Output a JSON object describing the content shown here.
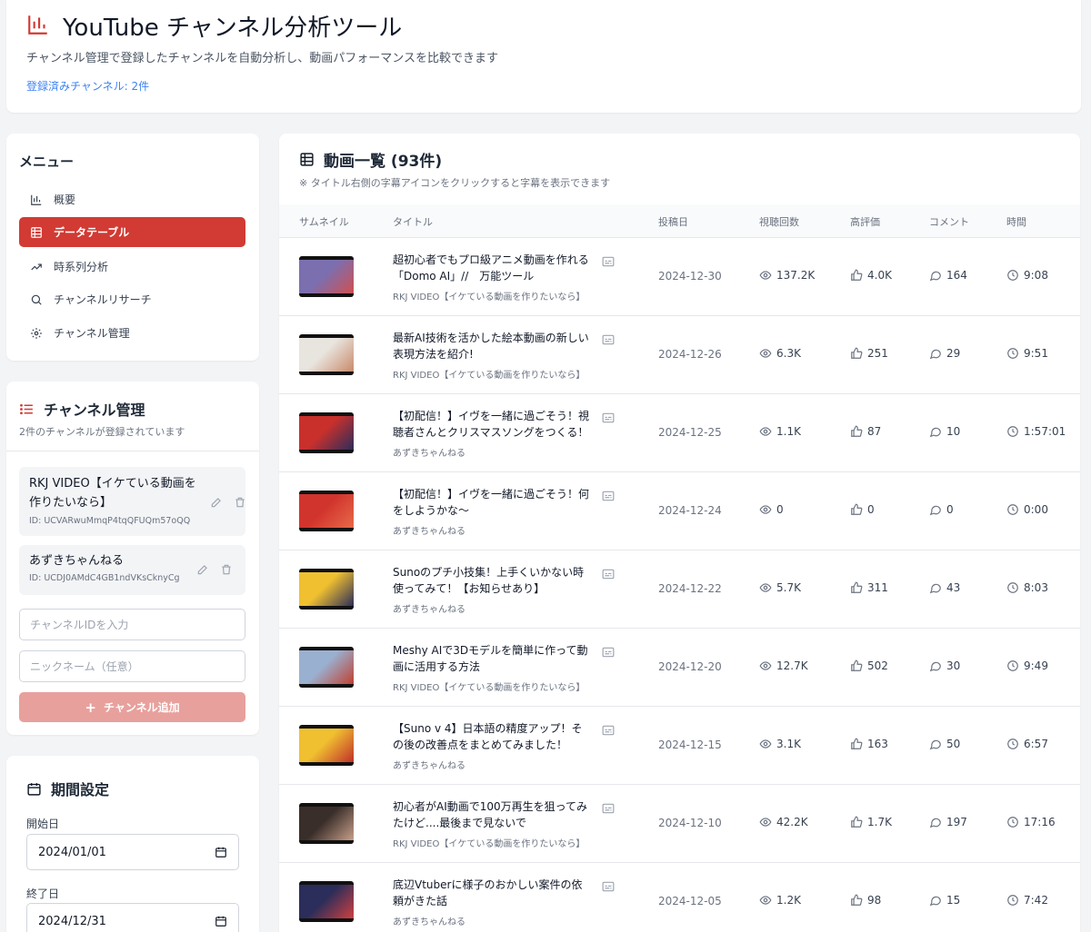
{
  "header": {
    "title": "YouTube チャンネル分析ツール",
    "subtitle": "チャンネル管理で登録したチャンネルを自動分析し、動画パフォーマンスを比較できます",
    "registered": "登録済みチャンネル: 2件",
    "icon": "bar-chart-icon"
  },
  "menu": {
    "heading": "メニュー",
    "items": [
      {
        "label": "概要",
        "icon": "bar-chart-icon",
        "active": false
      },
      {
        "label": "データテーブル",
        "icon": "table-icon",
        "active": true
      },
      {
        "label": "時系列分析",
        "icon": "trend-icon",
        "active": false
      },
      {
        "label": "チャンネルリサーチ",
        "icon": "search-icon",
        "active": false
      },
      {
        "label": "チャンネル管理",
        "icon": "gear-icon",
        "active": false
      }
    ]
  },
  "channel_mgmt": {
    "title": "チャンネル管理",
    "subtitle": "2件のチャンネルが登録されています",
    "channels": [
      {
        "name_line1": "RKJ VIDEO【イケている動画を",
        "name_line2": "作りたいなら】",
        "id": "ID: UCVARwuMmqP4tqQFUQm57oQQ"
      },
      {
        "name_line1": "あずきちゃんねる",
        "id": "ID: UCDJ0AMdC4GB1ndVKsCknyCg"
      }
    ],
    "id_placeholder": "チャンネルIDを入力",
    "nick_placeholder": "ニックネーム（任意）",
    "add_label": "チャンネル追加"
  },
  "period": {
    "title": "期間設定",
    "start_label": "開始日",
    "start_value": "2024/01/01",
    "end_label": "終了日",
    "end_value": "2024/12/31"
  },
  "videos": {
    "title": "動画一覧 (93件)",
    "note": "※ タイトル右側の字幕アイコンをクリックすると字幕を表示できます",
    "columns": [
      "サムネイル",
      "タイトル",
      "投稿日",
      "視聴回数",
      "高評価",
      "コメント",
      "時間"
    ],
    "rows": [
      {
        "title": "超初心者でもプロ級アニメ動画を作れる「Domo AI」//　万能ツール",
        "channel": "RKJ VIDEO【イケている動画を作りたいなら】",
        "date": "2024-12-30",
        "views": "137.2K",
        "likes": "4.0K",
        "comments": "164",
        "duration": "9:08",
        "thumb_colors": [
          "#7b6fb0",
          "#d05050"
        ]
      },
      {
        "title": "最新AI技術を活かした絵本動画の新しい表現方法を紹介!",
        "channel": "RKJ VIDEO【イケている動画を作りたいなら】",
        "date": "2024-12-26",
        "views": "6.3K",
        "likes": "251",
        "comments": "29",
        "duration": "9:51",
        "thumb_colors": [
          "#e8e4de",
          "#c88a6a"
        ]
      },
      {
        "title": "【初配信！】イヴを一緒に過ごそう！視聴者さんとクリスマスソングをつくる！",
        "channel": "あずきちゃんねる",
        "date": "2024-12-25",
        "views": "1.1K",
        "likes": "87",
        "comments": "10",
        "duration": "1:57:01",
        "thumb_colors": [
          "#c9302c",
          "#2b2d5a"
        ]
      },
      {
        "title": "【初配信！】イヴを一緒に過ごそう！何をしようかな〜",
        "channel": "あずきちゃんねる",
        "date": "2024-12-24",
        "views": "0",
        "likes": "0",
        "comments": "0",
        "duration": "0:00",
        "thumb_colors": [
          "#d1342c",
          "#e86a4a"
        ]
      },
      {
        "title": "Sunoのプチ小技集！上手くいかない時使ってみて！【お知らせあり】",
        "channel": "あずきちゃんねる",
        "date": "2024-12-22",
        "views": "5.7K",
        "likes": "311",
        "comments": "43",
        "duration": "8:03",
        "thumb_colors": [
          "#f0c030",
          "#2b2d5a"
        ]
      },
      {
        "title": "Meshy AIで3Dモデルを簡単に作って動画に活用する方法",
        "channel": "RKJ VIDEO【イケている動画を作りたいなら】",
        "date": "2024-12-20",
        "views": "12.7K",
        "likes": "502",
        "comments": "30",
        "duration": "9:49",
        "thumb_colors": [
          "#9ab0d0",
          "#c04030"
        ]
      },
      {
        "title": "【Suno v 4】日本語の精度アップ！その後の改善点をまとめてみました！",
        "channel": "あずきちゃんねる",
        "date": "2024-12-15",
        "views": "3.1K",
        "likes": "163",
        "comments": "50",
        "duration": "6:57",
        "thumb_colors": [
          "#f0c030",
          "#c0302a"
        ]
      },
      {
        "title": "初心者がAI動画で100万再生を狙ってみたけど....最後まで見ないで",
        "channel": "RKJ VIDEO【イケている動画を作りたいなら】",
        "date": "2024-12-10",
        "views": "42.2K",
        "likes": "1.7K",
        "comments": "197",
        "duration": "17:16",
        "thumb_colors": [
          "#3a2e2a",
          "#c8a08a"
        ]
      },
      {
        "title": "底辺Vtuberに様子のおかしい案件の依頼がきた話",
        "channel": "あずきちゃんねる",
        "date": "2024-12-05",
        "views": "1.2K",
        "likes": "98",
        "comments": "15",
        "duration": "7:42",
        "thumb_colors": [
          "#2b2d5a",
          "#d04040"
        ]
      }
    ]
  },
  "colors": {
    "accent": "#d13b34",
    "link": "#3b82f6",
    "add_button": "#e8a09c"
  }
}
